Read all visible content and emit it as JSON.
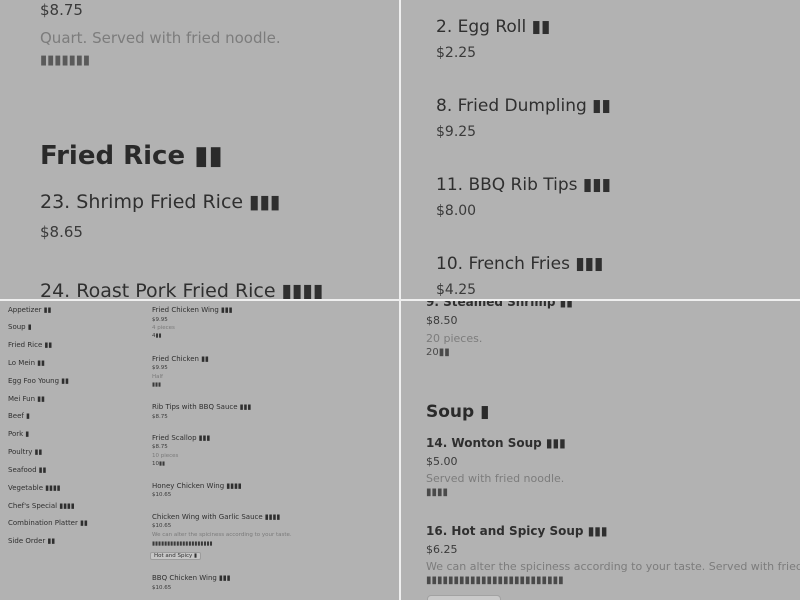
{
  "top_left": {
    "price_top": "$8.75",
    "desc": "Quart. Served with fried noodle.",
    "cjk": "▮▮▮▮▮▮▮",
    "section_title": "Fried Rice ▮▮",
    "items": [
      {
        "name": "23. Shrimp Fried Rice ▮▮▮",
        "price": "$8.65"
      },
      {
        "name": "24. Roast Pork Fried Rice ▮▮▮▮"
      }
    ]
  },
  "top_right": {
    "items": [
      {
        "name": "2. Egg Roll ▮▮",
        "price": "$2.25"
      },
      {
        "name": "8. Fried Dumpling ▮▮",
        "price": "$9.25"
      },
      {
        "name": "11. BBQ Rib Tips ▮▮▮",
        "price": "$8.00"
      },
      {
        "name": "10. French Fries ▮▮▮",
        "price": "$4.25"
      }
    ]
  },
  "bottom_left": {
    "categories": [
      "Appetizer ▮▮",
      "Soup ▮",
      "Fried Rice ▮▮",
      "Lo Mein ▮▮",
      "Egg Foo Young ▮▮",
      "Mei Fun ▮▮",
      "Beef ▮",
      "Pork ▮",
      "Poultry ▮▮",
      "Seafood ▮▮",
      "Vegetable ▮▮▮▮",
      "Chef's Special ▮▮▮▮",
      "Combination Platter ▮▮",
      "Side Order ▮▮"
    ],
    "items": {
      "i1": {
        "name": "Fried Chicken Wing ▮▮▮",
        "price": "$9.95",
        "sub": "4 pieces",
        "cjk": "4▮▮"
      },
      "i2": {
        "name": "Fried Chicken ▮▮",
        "price": "$9.95",
        "sub": "Half",
        "cjk": "▮▮▮"
      },
      "i3": {
        "name": "Rib Tips with BBQ Sauce ▮▮▮",
        "price": "$8.75"
      },
      "i4": {
        "name": "Fried Scallop ▮▮▮",
        "price": "$8.75",
        "sub": "10 pieces",
        "cjk": "10▮▮"
      },
      "i5": {
        "name": "Honey Chicken Wing ▮▮▮▮",
        "price": "$10.65"
      },
      "i6": {
        "name": "Chicken Wing with Garlic Sauce ▮▮▮▮",
        "price": "$10.65",
        "sub": "We can alter the spiciness according to your taste.",
        "cjk": "▮▮▮▮▮▮▮▮▮▮▮▮▮▮▮▮▮▮▮▮",
        "option": "Hot and Spicy ▮"
      },
      "i7": {
        "name": "BBQ Chicken Wing ▮▮▮",
        "price": "$10.65"
      }
    }
  },
  "bottom_right": {
    "top_item": {
      "name": "9. Steamed Shrimp ▮▮",
      "price": "$8.50",
      "sub": "20 pieces.",
      "cjk": "20▮▮"
    },
    "section_title": "Soup ▮",
    "items": [
      {
        "name": "14. Wonton Soup ▮▮▮",
        "price": "$5.00",
        "desc": "Served with fried noodle.",
        "cjk": "▮▮▮▮"
      },
      {
        "name": "16. Hot and Spicy Soup ▮▮▮",
        "price": "$6.25",
        "desc": "We can alter the spiciness according to your taste. Served with fried noodle.",
        "cjk": "▮▮▮▮▮▮▮▮▮▮▮▮▮▮▮▮▮▮▮▮▮▮▮▮▮"
      }
    ]
  }
}
